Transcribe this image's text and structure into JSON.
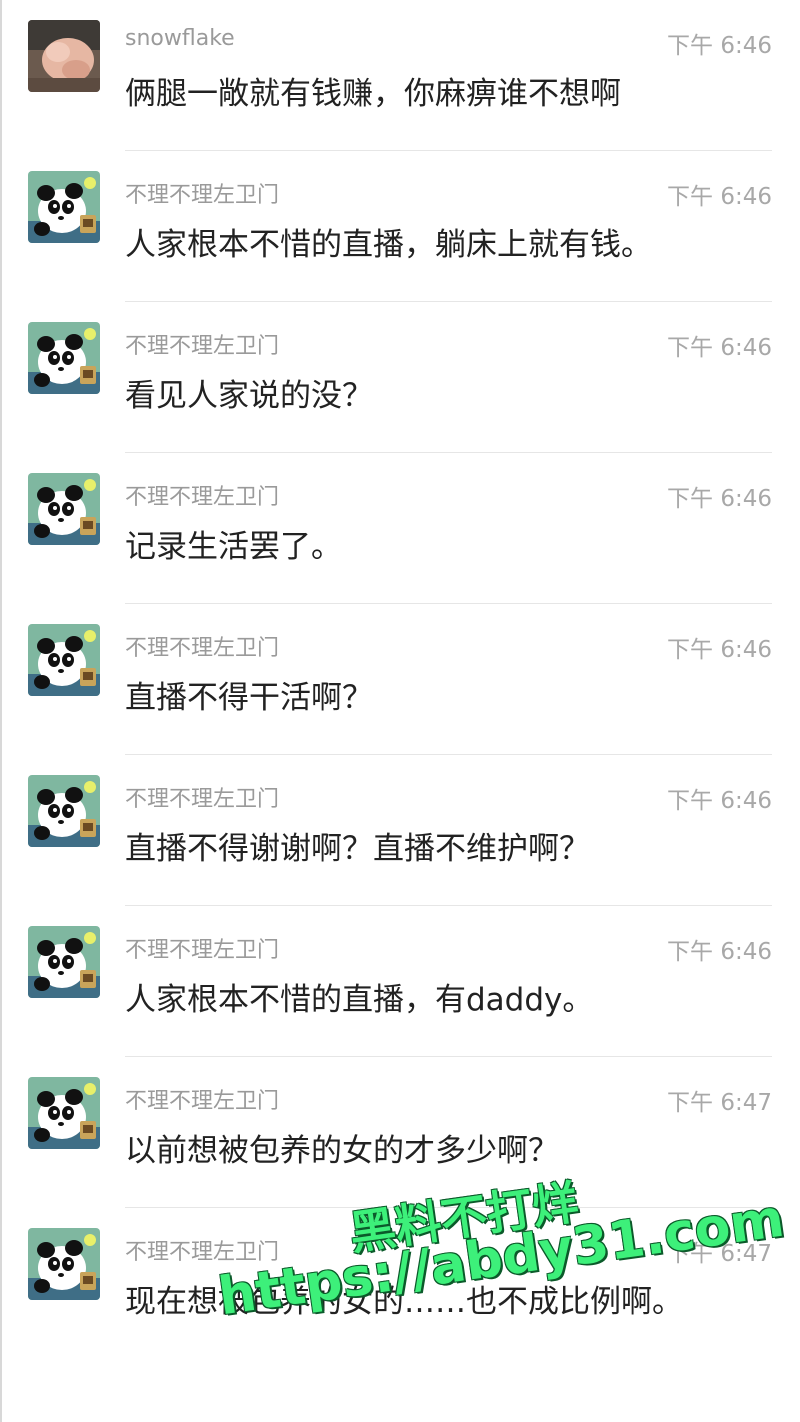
{
  "messages": [
    {
      "avatar": "photo-avatar",
      "name": "snowflake",
      "time": "下午 6:46",
      "text": "俩腿一敞就有钱赚，你麻痹谁不想啊"
    },
    {
      "avatar": "panda-avatar",
      "name": "不理不理左卫门",
      "time": "下午 6:46",
      "text": "人家根本不惜的直播，躺床上就有钱。"
    },
    {
      "avatar": "panda-avatar",
      "name": "不理不理左卫门",
      "time": "下午 6:46",
      "text": "看见人家说的没？"
    },
    {
      "avatar": "panda-avatar",
      "name": "不理不理左卫门",
      "time": "下午 6:46",
      "text": "记录生活罢了。"
    },
    {
      "avatar": "panda-avatar",
      "name": "不理不理左卫门",
      "time": "下午 6:46",
      "text": "直播不得干活啊？"
    },
    {
      "avatar": "panda-avatar",
      "name": "不理不理左卫门",
      "time": "下午 6:46",
      "text": "直播不得谢谢啊？直播不维护啊？"
    },
    {
      "avatar": "panda-avatar",
      "name": "不理不理左卫门",
      "time": "下午 6:46",
      "text": "人家根本不惜的直播，有daddy。"
    },
    {
      "avatar": "panda-avatar",
      "name": "不理不理左卫门",
      "time": "下午 6:47",
      "text": "以前想被包养的女的才多少啊？"
    },
    {
      "avatar": "panda-avatar",
      "name": "不理不理左卫门",
      "time": "下午 6:47",
      "text": "现在想被包养的女的……也不成比例啊。"
    }
  ],
  "watermark": {
    "line1": "黑料不打烊",
    "line2": "https://abdy31.com",
    "color": "#3df07a"
  },
  "colors": {
    "name": "#9a9a9a",
    "time": "#a8a8a8",
    "text": "#222222",
    "divider": "#e6e6e6"
  }
}
